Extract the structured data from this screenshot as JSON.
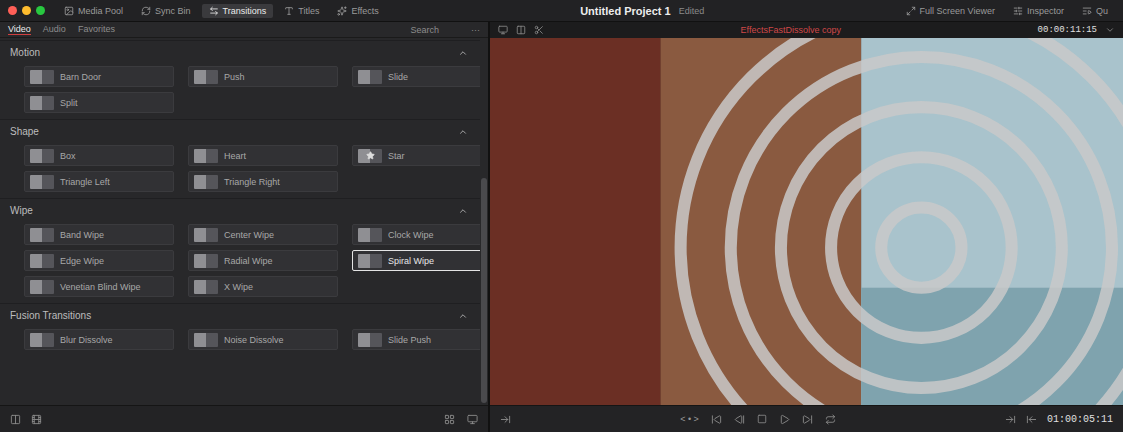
{
  "window": {
    "title": "Untitled Project 1",
    "status": "Edited"
  },
  "toolbar": [
    {
      "label": "Media Pool",
      "selected": false
    },
    {
      "label": "Sync Bin",
      "selected": false
    },
    {
      "label": "Transitions",
      "selected": true
    },
    {
      "label": "Titles",
      "selected": false
    },
    {
      "label": "Effects",
      "selected": false
    }
  ],
  "toolbar_right": [
    "Full Screen Viewer",
    "Inspector",
    "Qu"
  ],
  "panel": {
    "tabs": [
      {
        "label": "Video",
        "selected": true
      },
      {
        "label": "Audio",
        "selected": false
      },
      {
        "label": "Favorites",
        "selected": false
      }
    ],
    "search": "Search",
    "more": "···",
    "scrollbar": {
      "level": 0.62
    },
    "sections": [
      {
        "title": "Motion",
        "expanded": true,
        "items": [
          {
            "label": "Barn Door",
            "selected": false
          },
          {
            "label": "Push",
            "selected": false
          },
          {
            "label": "Slide",
            "selected": false
          },
          {
            "label": "Split",
            "selected": false
          }
        ]
      },
      {
        "title": "Shape",
        "expanded": true,
        "items": [
          {
            "label": "Box",
            "selected": false
          },
          {
            "label": "Heart",
            "selected": false
          },
          {
            "label": "Star",
            "selected": false
          },
          {
            "label": "Triangle Left",
            "selected": false
          },
          {
            "label": "Triangle Right",
            "selected": false
          }
        ]
      },
      {
        "title": "Wipe",
        "expanded": true,
        "items": [
          {
            "label": "Band Wipe",
            "selected": false
          },
          {
            "label": "Center Wipe",
            "selected": false
          },
          {
            "label": "Clock Wipe",
            "selected": false
          },
          {
            "label": "Edge Wipe",
            "selected": false
          },
          {
            "label": "Radial Wipe",
            "selected": false
          },
          {
            "label": "Spiral Wipe",
            "selected": true
          },
          {
            "label": "Venetian Blind Wipe",
            "selected": false
          },
          {
            "label": "X Wipe",
            "selected": false
          }
        ]
      },
      {
        "title": "Fusion Transitions",
        "expanded": true,
        "items": [
          {
            "label": "Blur Dissolve",
            "selected": false
          },
          {
            "label": "Noise Dissolve",
            "selected": false
          },
          {
            "label": "Slide Push",
            "selected": false
          }
        ]
      }
    ]
  },
  "viewer": {
    "clip": "EffectsFastDissolve copy",
    "timecode": "00:00:11:15",
    "jog": "< • >",
    "playhead": "01:00:05:11"
  }
}
